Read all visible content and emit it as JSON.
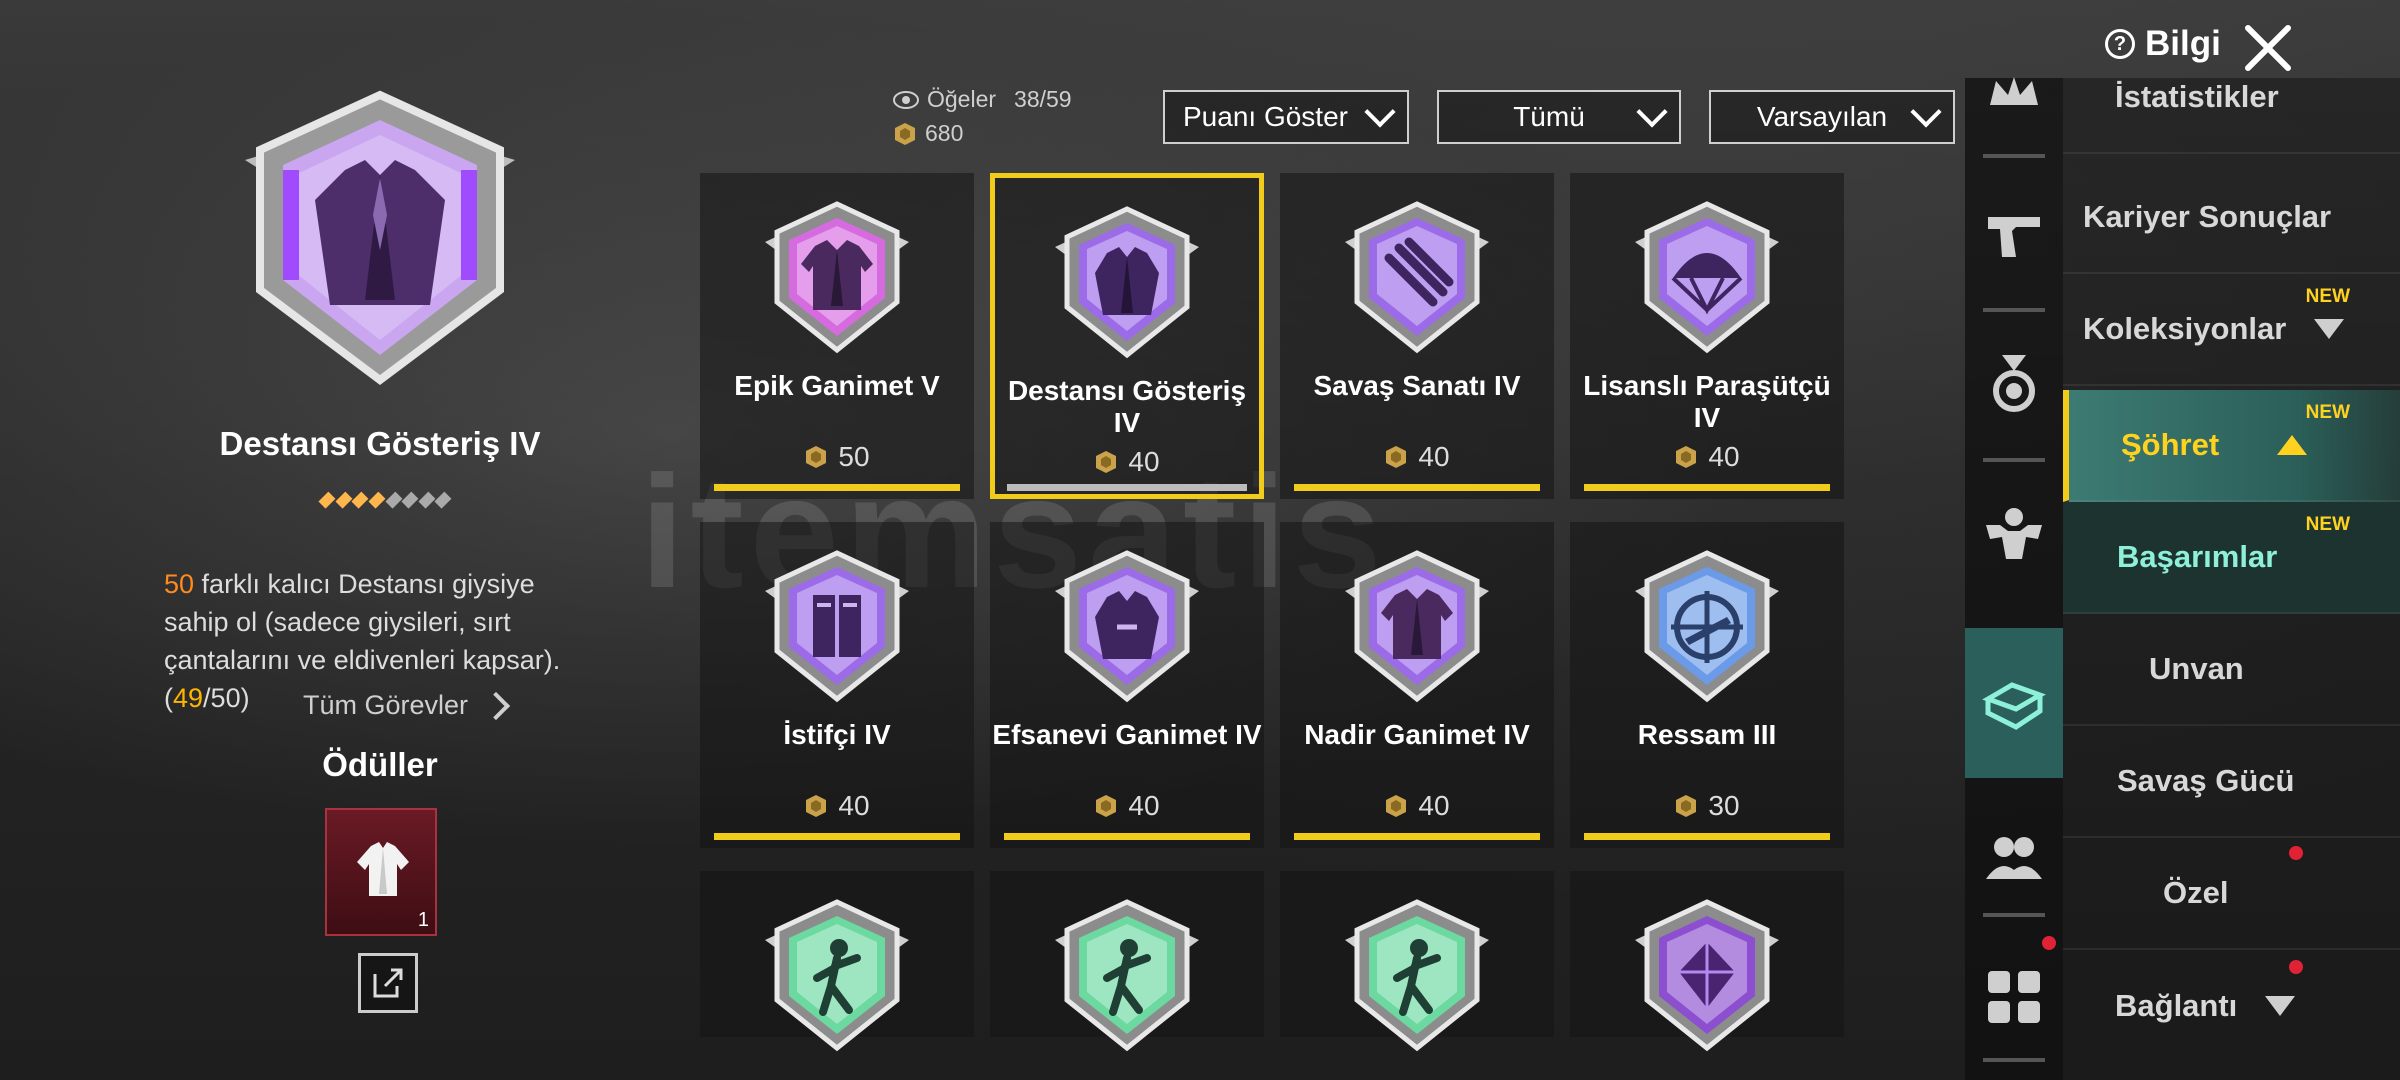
{
  "detail": {
    "title": "Destansı Gösteriş IV",
    "desc_count": "50",
    "desc_text": " farklı kalıcı Destansı giysiye sahip ol (sadece giysileri, sırt çantalarını ve eldivenleri kapsar). (",
    "progress_current": "49",
    "progress_rest": "/50)",
    "all_tasks_label": "Tüm Görevler",
    "rewards_title": "Ödüller",
    "reward_qty": "1",
    "rank_dot_colors": [
      "#ffb74d",
      "#ffb74d",
      "#ffb74d",
      "#ffb74d",
      "#aaaaaa",
      "#aaaaaa",
      "#aaaaaa",
      "#aaaaaa"
    ]
  },
  "stats": {
    "items_label": "Öğeler",
    "items_value": "38/59",
    "points_value": "680"
  },
  "filters": {
    "show_points": "Puanı Göster",
    "all": "Tümü",
    "default": "Varsayılan"
  },
  "cards": [
    {
      "name": "Epik Ganimet V",
      "points": "50",
      "color": "#d66be0",
      "icon": "jacket-icon",
      "selected": false
    },
    {
      "name": "Destansı Gösteriş IV",
      "points": "40",
      "color": "#9b6be8",
      "icon": "suit-icon",
      "selected": true
    },
    {
      "name": "Savaş Sanatı IV",
      "points": "40",
      "color": "#9b6be8",
      "icon": "claw-icon",
      "selected": false
    },
    {
      "name": "Lisanslı Paraşütçü IV",
      "points": "40",
      "color": "#9b6be8",
      "icon": "parachute-icon",
      "selected": false
    },
    {
      "name": "İstifçi IV",
      "points": "40",
      "color": "#9b6be8",
      "icon": "locker-icon",
      "selected": false
    },
    {
      "name": "Efsanevi Ganimet IV",
      "points": "40",
      "color": "#9b6be8",
      "icon": "robe-icon",
      "selected": false
    },
    {
      "name": "Nadir Ganimet IV",
      "points": "40",
      "color": "#9b6be8",
      "icon": "jacket-icon",
      "selected": false
    },
    {
      "name": "Ressam III",
      "points": "30",
      "color": "#6b9be8",
      "icon": "crosshair-icon",
      "selected": false
    },
    {
      "name": "",
      "points": "",
      "color": "#6bd9a0",
      "icon": "dancer-icon",
      "selected": false
    },
    {
      "name": "",
      "points": "",
      "color": "#6bd9a0",
      "icon": "dancer-icon",
      "selected": false
    },
    {
      "name": "",
      "points": "",
      "color": "#6bd9a0",
      "icon": "dancer-icon",
      "selected": false
    },
    {
      "name": "",
      "points": "",
      "color": "#8b4fcf",
      "icon": "gem-icon",
      "selected": false
    }
  ],
  "top": {
    "info_label": "Bilgi"
  },
  "menu": [
    {
      "label": "İstatistikler",
      "new": ""
    },
    {
      "label": "Kariyer Sonuçlar",
      "new": ""
    },
    {
      "label": "Koleksiyonlar",
      "new": "NEW"
    },
    {
      "label": "Şöhret",
      "new": "NEW"
    },
    {
      "label": "Başarımlar",
      "new": "NEW"
    },
    {
      "label": "Unvan",
      "new": ""
    },
    {
      "label": "Savaş Gücü",
      "new": ""
    },
    {
      "label": "Özel",
      "new": ""
    },
    {
      "label": "Bağlantı",
      "new": ""
    }
  ],
  "watermark": "itemsatis",
  "colors": {
    "accent": "#f2cc1a",
    "menu_active": "#3c7b73",
    "sub_text": "#8ff0d9",
    "new_tag": "#ffd21f"
  }
}
